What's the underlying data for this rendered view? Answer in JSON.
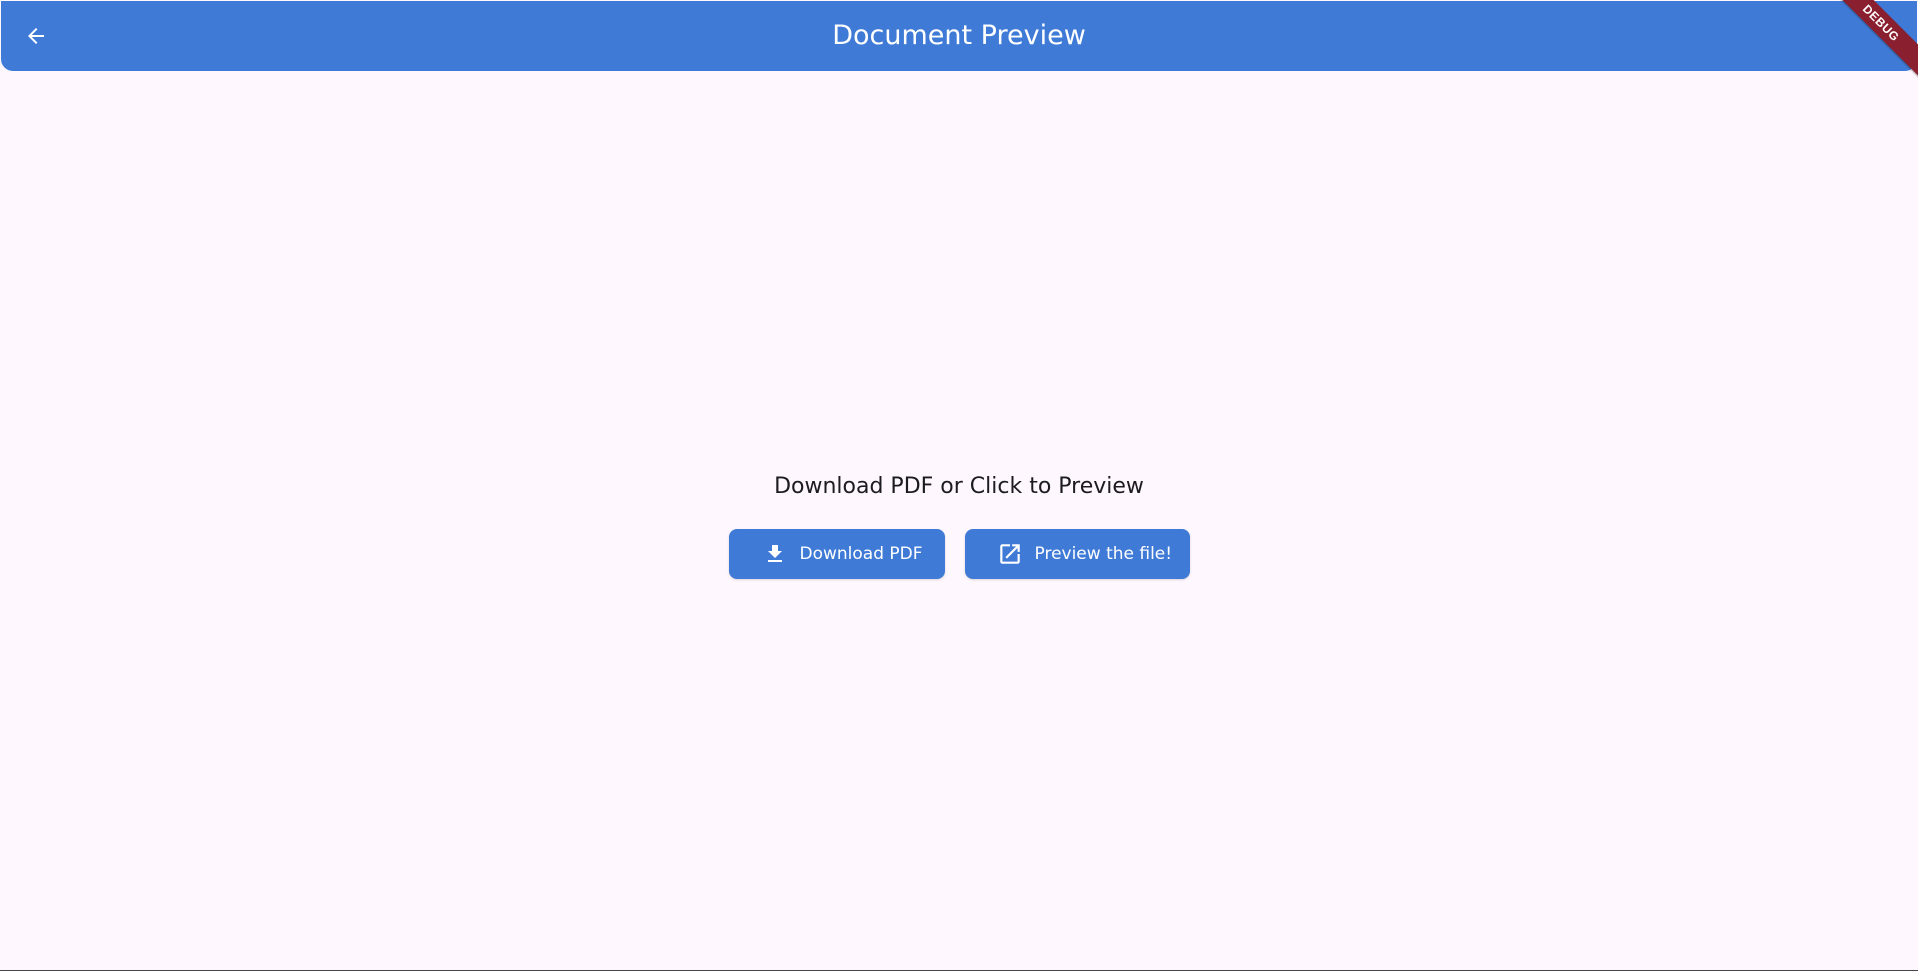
{
  "app_bar": {
    "title": "Document Preview",
    "back_icon": "arrow-back-icon",
    "color": "#3f7bd6"
  },
  "debug_banner": {
    "label": "DEBUG",
    "color": "#8a1f2f"
  },
  "main": {
    "prompt": "Download PDF or Click to Preview",
    "buttons": [
      {
        "label": "Download PDF",
        "icon": "download-icon"
      },
      {
        "label": "Preview the file!",
        "icon": "open-in-new-icon"
      }
    ]
  },
  "colors": {
    "background": "#fef7fe",
    "accent": "#3f7bd6"
  }
}
